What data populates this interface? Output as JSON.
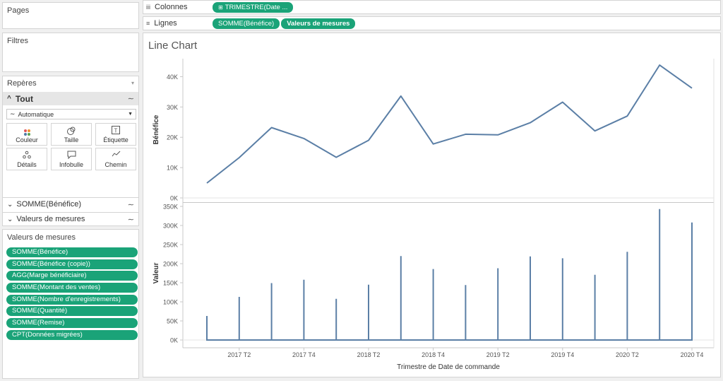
{
  "left": {
    "pages_title": "Pages",
    "filters_title": "Filtres",
    "marks": {
      "title": "Repères",
      "all_label": "Tout",
      "mark_type": "Automatique",
      "buttons": {
        "color": "Couleur",
        "size": "Taille",
        "label": "Étiquette",
        "detail": "Détails",
        "tooltip": "Infobulle",
        "path": "Chemin"
      },
      "sections": [
        "SOMME(Bénéfice)",
        "Valeurs de mesures"
      ]
    },
    "measure_values": {
      "title": "Valeurs de mesures",
      "items": [
        "SOMME(Bénéfice)",
        "SOMME(Bénéfice (copie))",
        "AGG(Marge bénéficiaire)",
        "SOMME(Montant des ventes)",
        "SOMME(Nombre d'enregistrements)",
        "SOMME(Quantité)",
        "SOMME(Remise)",
        "CPT(Données migrées)"
      ]
    }
  },
  "shelves": {
    "columns_label": "Colonnes",
    "columns_pills": [
      "TRIMESTRE(Date ..."
    ],
    "rows_label": "Lignes",
    "rows_pills": [
      "SOMME(Bénéfice)",
      "Valeurs de mesures"
    ]
  },
  "colors": {
    "pill": "#1aa378",
    "line": "#5b7fa6"
  },
  "chart_data": {
    "type": "line",
    "title": "Line Chart",
    "xlabel": "Trimestre de Date de commande",
    "x_categories": [
      "2017 T1",
      "2017 T2",
      "2017 T3",
      "2017 T4",
      "2018 T1",
      "2018 T2",
      "2018 T3",
      "2018 T4",
      "2019 T1",
      "2019 T2",
      "2019 T3",
      "2019 T4",
      "2020 T1",
      "2020 T2",
      "2020 T3",
      "2020 T4"
    ],
    "x_tick_labels": [
      "2017 T2",
      "2017 T4",
      "2018 T2",
      "2018 T4",
      "2019 T2",
      "2019 T4",
      "2020 T2",
      "2020 T4"
    ],
    "panes": [
      {
        "ylabel": "Bénéfice",
        "ylim": [
          0,
          45000
        ],
        "y_ticks": [
          0,
          10000,
          20000,
          30000,
          40000
        ],
        "y_tick_labels": [
          "0K",
          "10K",
          "20K",
          "30K",
          "40K"
        ],
        "series": [
          {
            "values": [
              4900,
              13300,
              23200,
              19600,
              13400,
              19000,
              33600,
              17800,
              21000,
              20800,
              24800,
              31600,
              22100,
              27000,
              43800,
              36200
            ]
          }
        ]
      },
      {
        "ylabel": "Valeur",
        "ylim": [
          0,
          350000
        ],
        "y_ticks": [
          0,
          50000,
          100000,
          150000,
          200000,
          250000,
          300000,
          350000
        ],
        "y_tick_labels": [
          "0K",
          "50K",
          "100K",
          "150K",
          "200K",
          "250K",
          "300K",
          "350K"
        ],
        "series": [
          {
            "values": [
              63000,
              113000,
              149000,
              158000,
              108000,
              145000,
              220000,
              186000,
              144000,
              188000,
              219000,
              214000,
              171000,
              231000,
              343000,
              308000
            ]
          }
        ]
      }
    ],
    "grid": false
  }
}
